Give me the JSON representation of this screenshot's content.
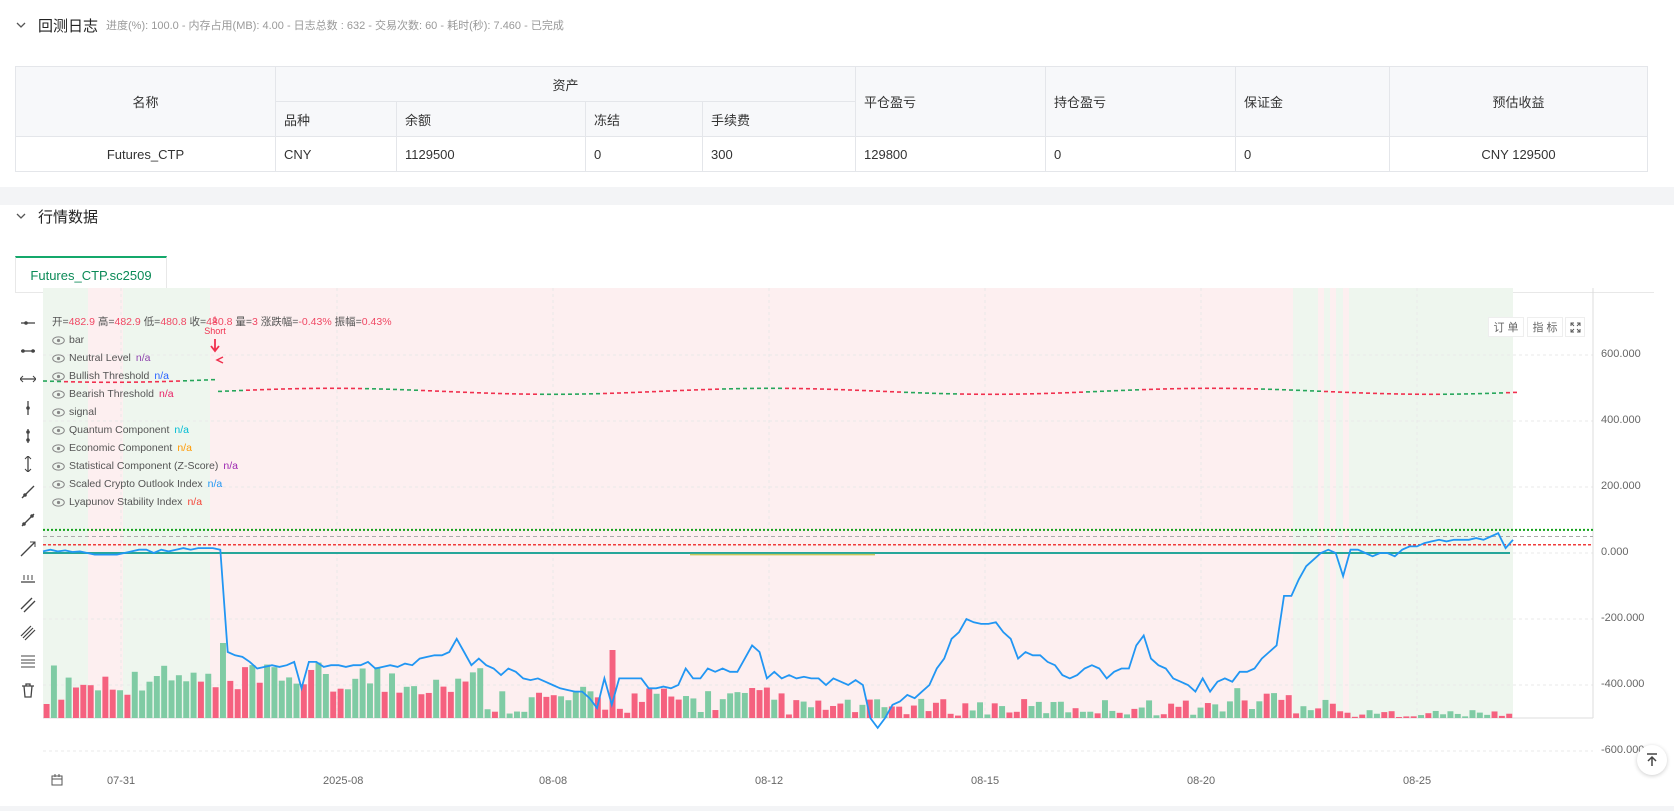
{
  "log": {
    "title": "回测日志",
    "status": "进度(%): 100.0 - 内存占用(MB): 4.00 - 日志总数 : 632 - 交易次数:  60 - 耗时(秒): 7.460 - 已完成"
  },
  "assets_table": {
    "headers": {
      "name": "名称",
      "assets": "资产",
      "variety": "品种",
      "balance": "余额",
      "frozen": "冻结",
      "fee": "手续费",
      "close_pnl": "平仓盈亏",
      "position_pnl": "持仓盈亏",
      "margin": "保证金",
      "est_profit": "预估收益"
    },
    "row": {
      "name": "Futures_CTP",
      "variety": "CNY",
      "balance": "1129500",
      "frozen": "0",
      "fee": "300",
      "close_pnl": "129800",
      "position_pnl": "0",
      "margin": "0",
      "est_profit": "CNY 129500"
    }
  },
  "market": {
    "title": "行情数据",
    "tab": "Futures_CTP.sc2509"
  },
  "chart": {
    "controls": {
      "order": "订 单",
      "indicator": "指 标"
    },
    "ohlc": {
      "open_label": "开=",
      "open": "482.9",
      "high_label": "高=",
      "high": "482.9",
      "low_label": "低=",
      "low": "480.8",
      "close_label": "收=",
      "close": "480.8",
      "vol_label": "量=",
      "vol": "3",
      "chg_label": "涨跌幅=",
      "chg": "-0.43%",
      "amp_label": "振幅=",
      "amp": "0.43%"
    },
    "legend": [
      {
        "name": "bar",
        "value": "",
        "color": "#555555"
      },
      {
        "name": "Neutral Level",
        "value": "n/a",
        "color": "#8e44ad"
      },
      {
        "name": "Bullish Threshold",
        "value": "n/a",
        "color": "#2962ff"
      },
      {
        "name": "Bearish Threshold",
        "value": "n/a",
        "color": "#e91e63"
      },
      {
        "name": "signal",
        "value": "",
        "color": "#555555"
      },
      {
        "name": "Quantum Component",
        "value": "n/a",
        "color": "#00bcd4"
      },
      {
        "name": "Economic Component",
        "value": "n/a",
        "color": "#ff9800"
      },
      {
        "name": "Statistical Component (Z-Score)",
        "value": "n/a",
        "color": "#9c27b0"
      },
      {
        "name": "Scaled Crypto Outlook Index",
        "value": "n/a",
        "color": "#2196f3"
      },
      {
        "name": "Lyapunov Stability Index",
        "value": "n/a",
        "color": "#f44336"
      }
    ],
    "signal_label": {
      "count": "1",
      "text": "Short"
    },
    "y_axis": [
      "600.000",
      "400.000",
      "200.000",
      "0.000",
      "-200.000",
      "-400.000",
      "-600.000"
    ],
    "x_axis": [
      "07-31",
      "2025-08",
      "08-08",
      "08-12",
      "08-15",
      "08-20",
      "08-25"
    ],
    "colors": {
      "up": "#7fcba4",
      "down": "#f5617f",
      "index_line": "#2196f3",
      "bull_thresh": "#14a31c",
      "bear_thresh": "#f03c3c"
    }
  },
  "chart_data": {
    "type": "line",
    "x_range": [
      "07-30",
      "08-27"
    ],
    "ylim": [
      -650,
      650
    ],
    "series": [
      {
        "name": "Scaled Crypto Outlook Index",
        "values": [
          5,
          10,
          5,
          8,
          3,
          5,
          0,
          -5,
          -5,
          -5,
          -5,
          0,
          5,
          10,
          10,
          0,
          10,
          5,
          10,
          15,
          10,
          15,
          15,
          15,
          10,
          -300,
          -310,
          -315,
          -330,
          -350,
          -345,
          -340,
          -345,
          -340,
          -330,
          -410,
          -330,
          -330,
          -345,
          -340,
          -340,
          -345,
          -340,
          -340,
          -330,
          -350,
          -345,
          -340,
          -345,
          -335,
          -340,
          -320,
          -315,
          -310,
          -310,
          -300,
          -260,
          -300,
          -340,
          -320,
          -340,
          -350,
          -370,
          -350,
          -360,
          -380,
          -385,
          -380,
          -390,
          -400,
          -410,
          -415,
          -420,
          -420,
          -440,
          -470,
          -380,
          -460,
          -380,
          -380,
          -380,
          -380,
          -410,
          -410,
          -405,
          -410,
          -400,
          -350,
          -380,
          -380,
          -350,
          -360,
          -350,
          -360,
          -360,
          -320,
          -280,
          -300,
          -380,
          -360,
          -380,
          -370,
          -380,
          -375,
          -380,
          -380,
          -400,
          -380,
          -390,
          -400,
          -385,
          -400,
          -500,
          -530,
          -500,
          -460,
          -450,
          -430,
          -440,
          -420,
          -400,
          -350,
          -320,
          -260,
          -240,
          -200,
          -210,
          -215,
          -215,
          -210,
          -240,
          -260,
          -320,
          -300,
          -310,
          -310,
          -330,
          -340,
          -370,
          -380,
          -370,
          -350,
          -340,
          -350,
          -380,
          -360,
          -350,
          -350,
          -280,
          -250,
          -320,
          -340,
          -350,
          -380,
          -390,
          -400,
          -420,
          -380,
          -420,
          -390,
          -380,
          -390,
          -360,
          -360,
          -350,
          -320,
          -300,
          -280,
          -130,
          -130,
          -80,
          -40,
          -20,
          0,
          10,
          0,
          -70,
          10,
          10,
          0,
          -10,
          0,
          0,
          -10,
          10,
          20,
          20,
          30,
          35,
          40,
          35,
          40,
          40,
          40,
          45,
          40,
          50,
          60,
          15,
          40
        ]
      }
    ],
    "bullish_threshold": 70,
    "bearish_threshold": 25,
    "neutral_level": 50,
    "price_series_level": 490,
    "short_signal_at": "08-04"
  }
}
